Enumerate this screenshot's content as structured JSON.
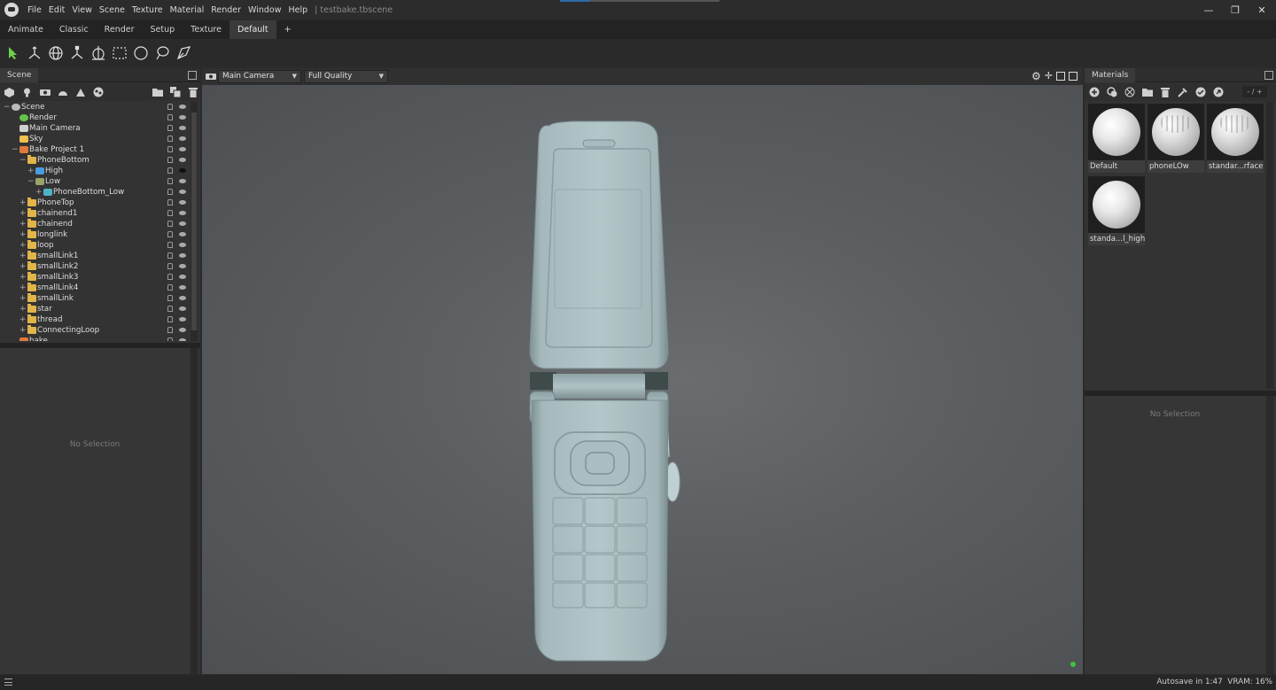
{
  "menubar": {
    "items": [
      "File",
      "Edit",
      "View",
      "Scene",
      "Texture",
      "Material",
      "Render",
      "Window",
      "Help"
    ],
    "file_title": "|  testbake.tbscene"
  },
  "window_controls": [
    "—",
    "❐",
    "✕"
  ],
  "tabs": [
    {
      "label": "Animate",
      "active": false
    },
    {
      "label": "Classic",
      "active": false
    },
    {
      "label": "Render",
      "active": false
    },
    {
      "label": "Setup",
      "active": false
    },
    {
      "label": "Texture",
      "active": false
    },
    {
      "label": "Default",
      "active": true
    },
    {
      "label": "+",
      "active": false
    }
  ],
  "toolbar": {
    "tools": [
      "select-arrow-icon",
      "translate-icon",
      "rotate-icon",
      "scale-icon",
      "transform-all-icon",
      "rect-select-icon",
      "ellipse-select-icon",
      "lasso-select-icon",
      "paint-select-icon"
    ]
  },
  "scene": {
    "tab_label": "Scene",
    "icons": [
      "add-mesh-icon",
      "add-light-icon",
      "add-camera-icon",
      "add-sky-icon",
      "add-render-icon",
      "add-baker-icon",
      "add-folder-icon",
      "duplicate-icon",
      "delete-icon"
    ],
    "tree": [
      {
        "label": "Scene",
        "indent": 0,
        "kind": "scene",
        "expander": "−"
      },
      {
        "label": "Render",
        "indent": 1,
        "kind": "render",
        "expander": ""
      },
      {
        "label": "Main Camera",
        "indent": 1,
        "kind": "camera",
        "expander": ""
      },
      {
        "label": "Sky",
        "indent": 1,
        "kind": "sky",
        "expander": ""
      },
      {
        "label": "Bake Project 1",
        "indent": 1,
        "kind": "bake",
        "expander": "−"
      },
      {
        "label": "PhoneBottom",
        "indent": 2,
        "kind": "folder",
        "expander": "−"
      },
      {
        "label": "High",
        "indent": 3,
        "kind": "high",
        "expander": "+",
        "eye_dark": true
      },
      {
        "label": "Low",
        "indent": 3,
        "kind": "low",
        "expander": "−"
      },
      {
        "label": "PhoneBottom_Low",
        "indent": 4,
        "kind": "mesh",
        "expander": "+"
      },
      {
        "label": "PhoneTop",
        "indent": 2,
        "kind": "folder",
        "expander": "+"
      },
      {
        "label": "chainend1",
        "indent": 2,
        "kind": "folder",
        "expander": "+"
      },
      {
        "label": "chainend",
        "indent": 2,
        "kind": "folder",
        "expander": "+"
      },
      {
        "label": "longlink",
        "indent": 2,
        "kind": "folder",
        "expander": "+"
      },
      {
        "label": "loop",
        "indent": 2,
        "kind": "folder",
        "expander": "+"
      },
      {
        "label": "smallLink1",
        "indent": 2,
        "kind": "folder",
        "expander": "+"
      },
      {
        "label": "smallLink2",
        "indent": 2,
        "kind": "folder",
        "expander": "+"
      },
      {
        "label": "smallLink3",
        "indent": 2,
        "kind": "folder",
        "expander": "+"
      },
      {
        "label": "smallLink4",
        "indent": 2,
        "kind": "folder",
        "expander": "+"
      },
      {
        "label": "smallLink",
        "indent": 2,
        "kind": "folder",
        "expander": "+"
      },
      {
        "label": "star",
        "indent": 2,
        "kind": "folder",
        "expander": "+"
      },
      {
        "label": "thread",
        "indent": 2,
        "kind": "folder",
        "expander": "+"
      },
      {
        "label": "ConnectingLoop",
        "indent": 2,
        "kind": "folder",
        "expander": "+"
      },
      {
        "label": "bake",
        "indent": 1,
        "kind": "bake",
        "expander": ""
      }
    ],
    "no_selection": "No Selection"
  },
  "viewport": {
    "camera_select": "Main Camera",
    "quality_select": "Full Quality",
    "tools": [
      "gear-icon",
      "move-view-icon",
      "maximize-icon",
      "popout-icon"
    ]
  },
  "materials": {
    "tab_label": "Materials",
    "icons": [
      "add-material-icon",
      "duplicate-material-icon",
      "checker-icon",
      "folder-icon",
      "delete-icon",
      "eyedropper-icon",
      "apply-icon",
      "reset-icon"
    ],
    "page": "- / +",
    "items": [
      {
        "label": "Default",
        "textured": false
      },
      {
        "label": "phoneLOw",
        "textured": true
      },
      {
        "label": "standar...rface1",
        "textured": true
      },
      {
        "label": "standa...l_high",
        "textured": false
      }
    ],
    "no_selection": "No Selection"
  },
  "status": {
    "autosave": "Autosave in 1:47",
    "vram": "VRAM: 16%"
  },
  "colors": {
    "accent": "#2d6aa8",
    "folder": "#e1b54a",
    "ok_dot": "#3fc33f"
  }
}
